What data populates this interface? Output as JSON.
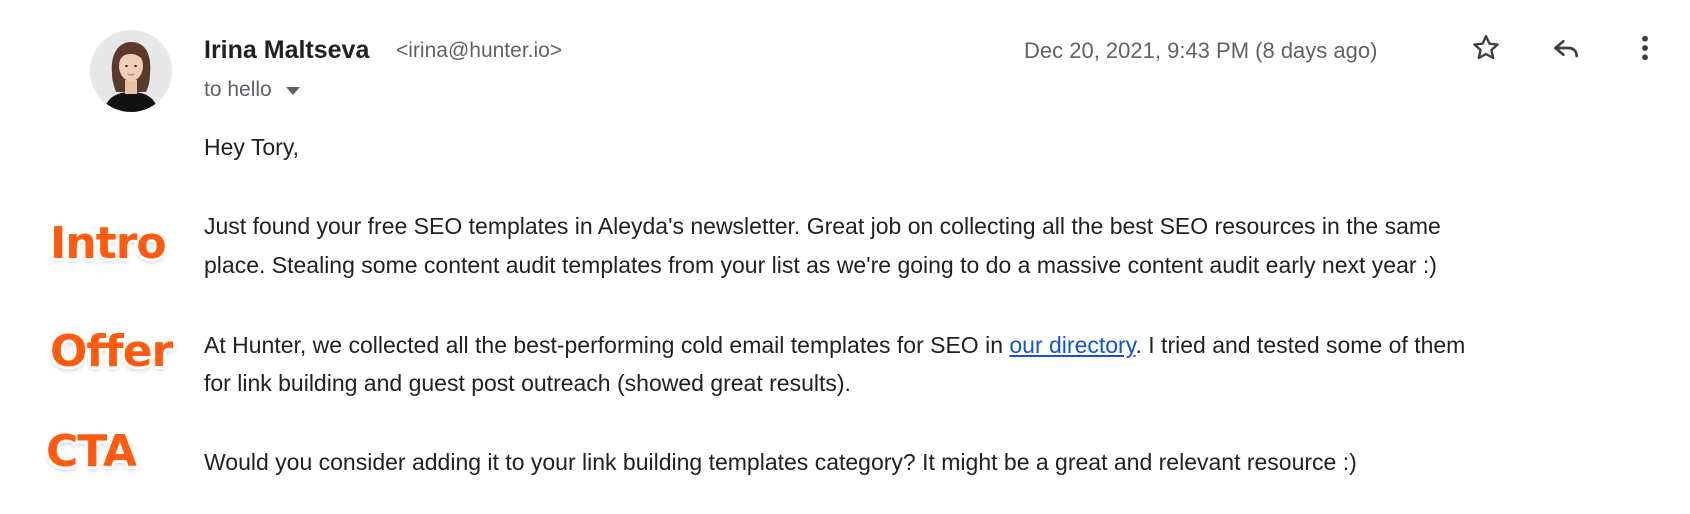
{
  "email": {
    "sender_name": "Irina Maltseva",
    "sender_email": "<irina@hunter.io>",
    "recipient_line": "to hello",
    "date": "Dec 20, 2021, 9:43 PM (8 days ago)",
    "actions": {
      "star_icon": "star-outline",
      "reply_icon": "reply-arrow",
      "more_icon": "vertical-ellipsis"
    }
  },
  "body": {
    "greeting": "Hey Tory,",
    "intro_line1": "Just found your free SEO templates in Aleyda's newsletter. Great job on collecting all the best SEO resources in the same",
    "intro_line2": "place. Stealing some content audit templates from your list as we're going to do a massive content audit early next year :)",
    "offer_line1_before": "At Hunter, we collected all the best-performing cold email templates for SEO in ",
    "offer_link": "our directory",
    "offer_line1_after": ". I tried and tested some of them",
    "offer_line2": "for link building and guest post outreach (showed great results).",
    "cta_line": "Would you consider adding it to your link building templates category? It might be a great and relevant resource :)"
  },
  "annotations": {
    "intro": "Intro",
    "offer": "Offer",
    "cta": "CTA"
  },
  "colors": {
    "annotation": "#ff5a0d",
    "link": "#1155cc",
    "muted_text": "#5f6368"
  }
}
